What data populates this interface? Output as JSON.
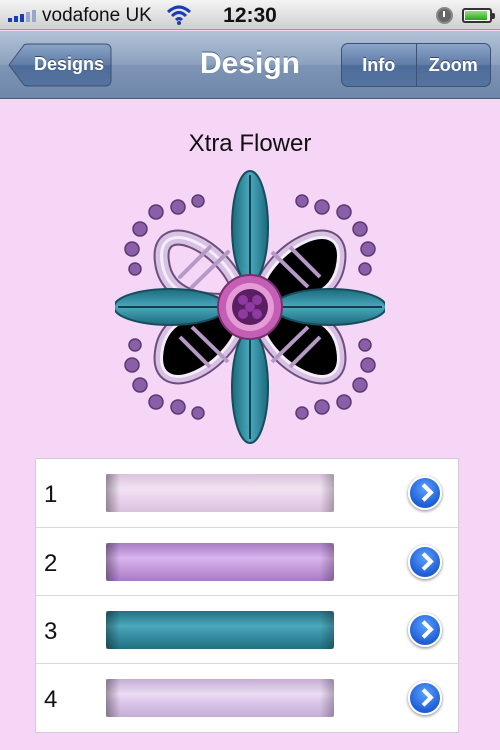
{
  "status_bar": {
    "carrier": "vodafone UK",
    "time": "12:30",
    "signal_icon": "signal-bars-icon",
    "wifi_icon": "wifi-icon",
    "alarm_icon": "alarm-clock-icon",
    "battery_icon": "battery-icon"
  },
  "nav": {
    "title": "Design",
    "back_label": "Designs",
    "segments": [
      {
        "label": "Info"
      },
      {
        "label": "Zoom"
      }
    ]
  },
  "design": {
    "name": "Xtra Flower"
  },
  "threads": [
    {
      "number": "1",
      "color": "#ecd6ee",
      "color_dark": "#c8a6cc"
    },
    {
      "number": "2",
      "color": "#c9a0e0",
      "color_dark": "#9f6fbf"
    },
    {
      "number": "3",
      "color": "#3a93a8",
      "color_dark": "#1e6a7c"
    },
    {
      "number": "4",
      "color": "#dcc6ea",
      "color_dark": "#b39cc5"
    }
  ],
  "colors": {
    "background": "#f6d6f6",
    "nav_bar": "#7d94b5",
    "disclosure": "#1e5ed6"
  }
}
